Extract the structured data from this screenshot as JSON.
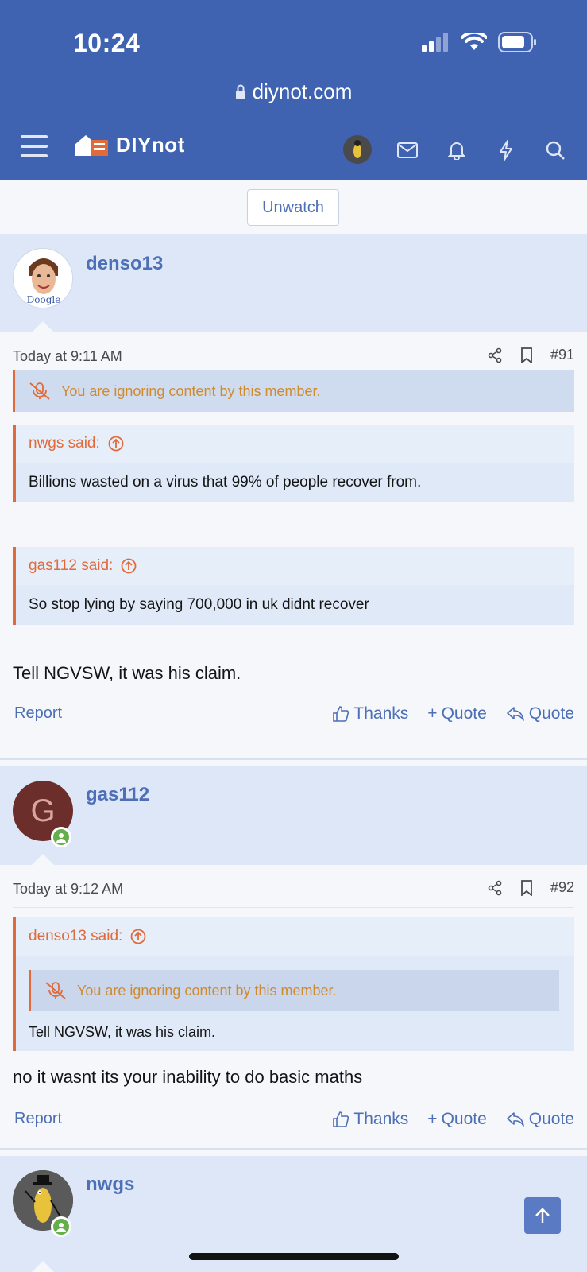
{
  "status_bar": {
    "time": "10:24"
  },
  "browser": {
    "url": "diynot.com"
  },
  "site": {
    "logo_text": "DIYnot"
  },
  "unwatch_label": "Unwatch",
  "posts": [
    {
      "username": "denso13",
      "date": "Today at 9:11 AM",
      "post_number": "#91",
      "ignored_notice": "You are ignoring content by this member.",
      "quotes": [
        {
          "author": "nwgs said:",
          "text": "Billions wasted on a virus that 99% of people recover from."
        },
        {
          "author": "gas112 said:",
          "text": "So stop lying by saying 700,000 in uk didnt recover"
        }
      ],
      "text": "Tell NGVSW, it was his claim.",
      "report_label": "Report",
      "thanks_label": "Thanks",
      "multiquote_label": "Quote",
      "quote_label": "Quote"
    },
    {
      "username": "gas112",
      "avatar_letter": "G",
      "date": "Today at 9:12 AM",
      "post_number": "#92",
      "quotes": [
        {
          "author": "denso13 said:",
          "ignored_notice": "You are ignoring content by this member.",
          "text": "Tell NGVSW, it was his claim."
        }
      ],
      "text": "no it wasnt its your inability to do basic maths",
      "report_label": "Report",
      "thanks_label": "Thanks",
      "multiquote_label": "Quote",
      "quote_label": "Quote"
    },
    {
      "username": "nwgs"
    }
  ],
  "avatar_caption": "Doogle",
  "colors": {
    "header": "#3f63b1",
    "accent": "#4d6fb6",
    "quote_border": "#e06a3a",
    "ignored_text": "#d08a2e",
    "online": "#63b04a"
  }
}
